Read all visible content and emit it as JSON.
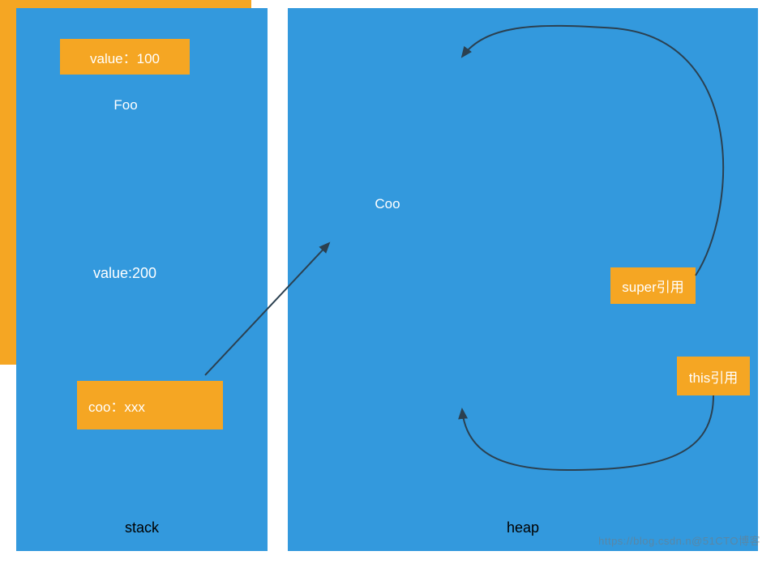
{
  "stack": {
    "label": "stack",
    "coo_ref": "coo：xxx"
  },
  "heap": {
    "label": "heap",
    "coo_outer": {
      "foo_label": "Foo",
      "coo_label": "Coo",
      "value_100": "value：100",
      "value_200": "value:200"
    },
    "super_ref": "super引用",
    "this_ref": "this引用"
  },
  "watermark": "https://blog.csdn.n@51CTO博客"
}
